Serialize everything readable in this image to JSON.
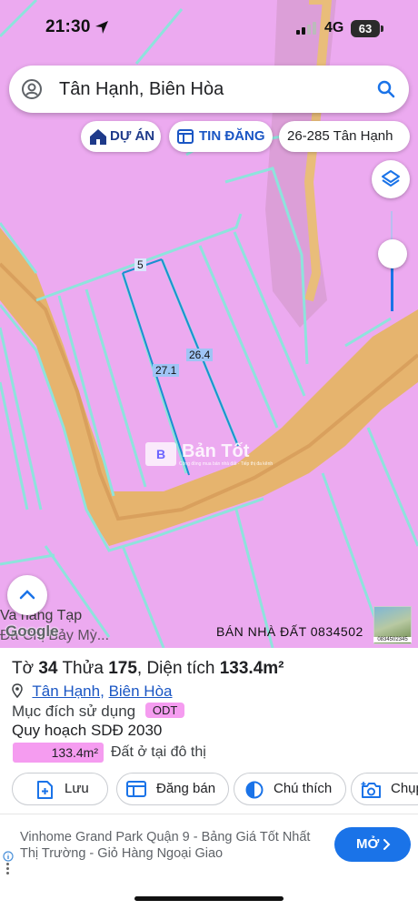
{
  "status_bar": {
    "time": "21:30",
    "network": "4G",
    "battery": "63"
  },
  "search": {
    "query": "Tân Hạnh, Biên Hòa"
  },
  "chips": {
    "project": "DỰ ÁN",
    "listings": "TIN ĐĂNG",
    "parcel": "26-285 Tân Hạnh"
  },
  "map": {
    "dimension_top": "5",
    "dimension_left": "27.1",
    "dimension_right": "26.4",
    "place_label_1": "Va hang Tạp",
    "place_label_2": "Đa Chị Bảy Mỳ...",
    "google": "Google",
    "watermark_box": "B",
    "watermark_name": "Bản Tốt",
    "watermark_tag": "Cộng đồng mua bán nhà đất - Tiếp thị đa kênh",
    "ad_banner": "BÁN NHÀ ĐẤT 0834502",
    "ad_thumb_phone": "0834502345",
    "colors": {
      "land": "#ecaaf0",
      "parcel_border": "#8ee3dc",
      "road": "#e6b46e",
      "road_center": "#d9a05d",
      "dimension_line": "#1a8fd0"
    }
  },
  "sheet": {
    "title_prefix": "Tờ",
    "sheet_no": "34",
    "parcel_label": "Thửa",
    "parcel_no": "175",
    "area_label": "Diện tích",
    "area_value": "133.4m²",
    "ward": "Tân Hạnh",
    "separator": ",",
    "city": "Biên Hòa",
    "purpose_label": "Mục đích sử dụng",
    "purpose_code": "ODT",
    "plan_label": "Quy hoạch SDĐ 2030",
    "plan_area": "133.4m²",
    "plan_desc": "Đất ở tại đô thị",
    "actions": {
      "save": "Lưu",
      "post": "Đăng bán",
      "legend": "Chú thích",
      "photo": "Chụp"
    }
  },
  "ad": {
    "text": "Vinhome Grand Park Quận 9 - Bảng Giá Tốt Nhất Thị Trường - Giỏ Hàng Ngoại Giao",
    "button": "MỞ"
  }
}
